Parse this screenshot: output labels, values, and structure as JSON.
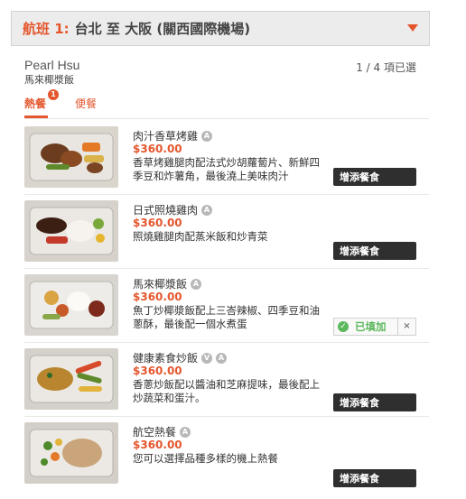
{
  "flight": {
    "label": "航班 1:",
    "route": "台北 至 大阪 (關西國際機場)",
    "toggle_icon": "chevron-down-icon"
  },
  "passenger": {
    "name": "Pearl Hsu",
    "meal": "馬來椰漿飯",
    "count": "1 / 4 項已選"
  },
  "tabs": [
    {
      "label": "熱餐",
      "badge": "1",
      "active": true
    },
    {
      "label": "便餐",
      "active": false
    }
  ],
  "meals": [
    {
      "name": "肉汁香草烤雞",
      "info_icon": "A",
      "price": "$360.00",
      "description": "香草烤雞腿肉配法式炒胡蘿蔔片、新鮮四季豆和炸薯角，最後澆上美味肉汁",
      "action": "增添餐食"
    },
    {
      "name": "日式照燒雞肉",
      "info_icon": "A",
      "price": "$360.00",
      "description": "照燒雞腿肉配蒸米飯和炒青菜",
      "action": "增添餐食"
    },
    {
      "name": "馬來椰漿飯",
      "info_icon": "A",
      "price": "$360.00",
      "description": "魚丁炒椰漿飯配上三峇辣椒、四季豆和油蔥酥，最後配一個水煮蛋",
      "status": "已填加",
      "remove": "×"
    },
    {
      "name": "健康素食炒飯",
      "info_icon": "V",
      "info_icon2": "A",
      "price": "$360.00",
      "description": "香蔥炒飯配以醬油和芝麻提味，最後配上炒蔬菜和蛋汁。",
      "action": "增添餐食"
    },
    {
      "name": "航空熱餐",
      "info_icon": "A",
      "price": "$360.00",
      "description": "您可以選擇品種多樣的機上熱餐",
      "action": "增添餐食"
    }
  ],
  "colors": {
    "accent": "#e4572e",
    "added": "#5cb85c",
    "button": "#2f2f2f"
  }
}
